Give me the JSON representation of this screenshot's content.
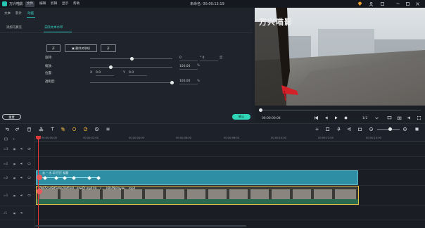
{
  "titlebar": {
    "app_name": "万兴喵影",
    "menus": [
      "文件",
      "编辑",
      "剪辑",
      "显示",
      "帮助"
    ],
    "project_title": "未命名: 00:00:13:19"
  },
  "panel_tabs": [
    "文本",
    "影片",
    "动画"
  ],
  "sub_tabs": {
    "mosaic": "添加马赛克",
    "remove_watermark": "去除文本水印"
  },
  "controls": {
    "toggle_label": "开",
    "delete_watermark_button": "删除关联帧",
    "keyframe_button": "开"
  },
  "fields": {
    "rotation": {
      "label": "旋转:",
      "value": "0",
      "value2": "0",
      "unit": "度",
      "level": 0.5
    },
    "scale": {
      "label": "缩放:",
      "value": "100.00",
      "unit": "%",
      "level": 0.25
    },
    "position": {
      "label": "位置:",
      "x_label": "X",
      "x_value": "0.0",
      "y_label": "Y",
      "y_value": "0.0"
    },
    "opacity": {
      "label": "透明度:",
      "value": "100.00",
      "unit": "%",
      "level": 1.0
    }
  },
  "buttons": {
    "reset": "重置",
    "ok": "确认"
  },
  "preview": {
    "watermark_title": "万兴喵影",
    "timecode": "00:00:00:04",
    "ratio": "1/2",
    "progress": 0.0
  },
  "ruler_ticks": [
    "00:00:00:00",
    "00:00:02:00",
    "00:00:04:00",
    "00:00:06:00",
    "00:00:08:00",
    "00:00:10:00",
    "00:00:12:00",
    "00:00:14:00"
  ],
  "timeline": {
    "effect_clip_label": "去 -- 水 印  打打 标题",
    "video_clip_label": "0b65cad8d5d4e28d5fe0...kzwQ!.mp4!dr... / ... .b0a!Nshaylw... .mp4"
  },
  "colors": {
    "accent": "#25c6b4",
    "effect_clip": "#2e8ea3",
    "video_border": "#e3c24a",
    "playhead": "#e23a3a"
  }
}
